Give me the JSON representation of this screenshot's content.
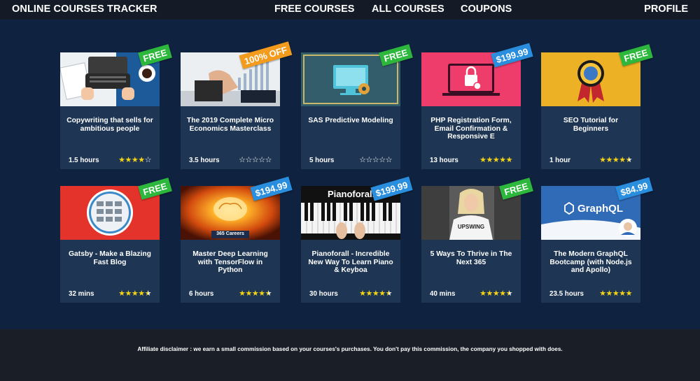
{
  "nav": {
    "brand": "ONLINE COURSES TRACKER",
    "links": [
      "FREE COURSES",
      "ALL COURSES",
      "COUPONS"
    ],
    "profile": "PROFILE"
  },
  "colors": {
    "page_bg": "#0f2240",
    "card_bg": "#1e3653",
    "star": "#f5d315",
    "badge_free": "#2db83d",
    "badge_price": "#2a8ede",
    "badge_off": "#f29b1c"
  },
  "courses": [
    {
      "title": "Copywriting that sells for ambitious people",
      "duration": "1.5 hours",
      "rating": 4,
      "badge": "FREE",
      "badge_type": "green",
      "thumb": "typewriter-image"
    },
    {
      "title": "The 2019 Complete Micro Economics Masterclass",
      "duration": "3.5 hours",
      "rating": 0,
      "badge": "100% OFF",
      "badge_type": "orange",
      "thumb": "stock-chart-image"
    },
    {
      "title": "SAS Predictive Modeling",
      "duration": "5 hours",
      "rating": 0,
      "badge": "FREE",
      "badge_type": "green",
      "thumb": "computer-gear-image"
    },
    {
      "title": "PHP Registration Form, Email Confirmation & Responsive E",
      "duration": "13 hours",
      "rating": 5,
      "badge": "$199.99",
      "badge_type": "blue",
      "thumb": "laptop-lock-image"
    },
    {
      "title": "SEO Tutorial for Beginners",
      "duration": "1 hour",
      "rating": 4.5,
      "badge": "FREE",
      "badge_type": "green",
      "thumb": "google-medal-image"
    },
    {
      "title": "Gatsby - Make a Blazing Fast Blog",
      "duration": "32 mins",
      "rating": 4.5,
      "badge": "FREE",
      "badge_type": "green",
      "thumb": "blog-grid-image"
    },
    {
      "title": "Master Deep Learning with TensorFlow in Python",
      "duration": "6 hours",
      "rating": 4.5,
      "badge": "$194.99",
      "badge_type": "blue",
      "thumb": "glowing-brain-image",
      "thumb_label": "365 Careers"
    },
    {
      "title": "Pianoforall - Incredible New Way To Learn Piano & Keyboa",
      "duration": "30 hours",
      "rating": 4.5,
      "badge": "$199.99",
      "badge_type": "blue",
      "thumb": "piano-keys-image",
      "thumb_label": "Pianoforall"
    },
    {
      "title": "5 Ways To Thrive in The Next 365",
      "duration": "40 mins",
      "rating": 4.5,
      "badge": "FREE",
      "badge_type": "green",
      "thumb": "woman-portrait-image",
      "thumb_label": "UPSWING"
    },
    {
      "title": "The Modern GraphQL Bootcamp (with Node.js and Apollo)",
      "duration": "23.5 hours",
      "rating": 5,
      "badge": "$84.99",
      "badge_type": "blue",
      "thumb": "graphql-logo-image",
      "thumb_label": "GraphQL"
    }
  ],
  "footer": {
    "disclaimer": "Affiliate disclaimer : we earn a small commission based on your courses's purchases. You don't pay this commission, the company you shopped with does."
  }
}
